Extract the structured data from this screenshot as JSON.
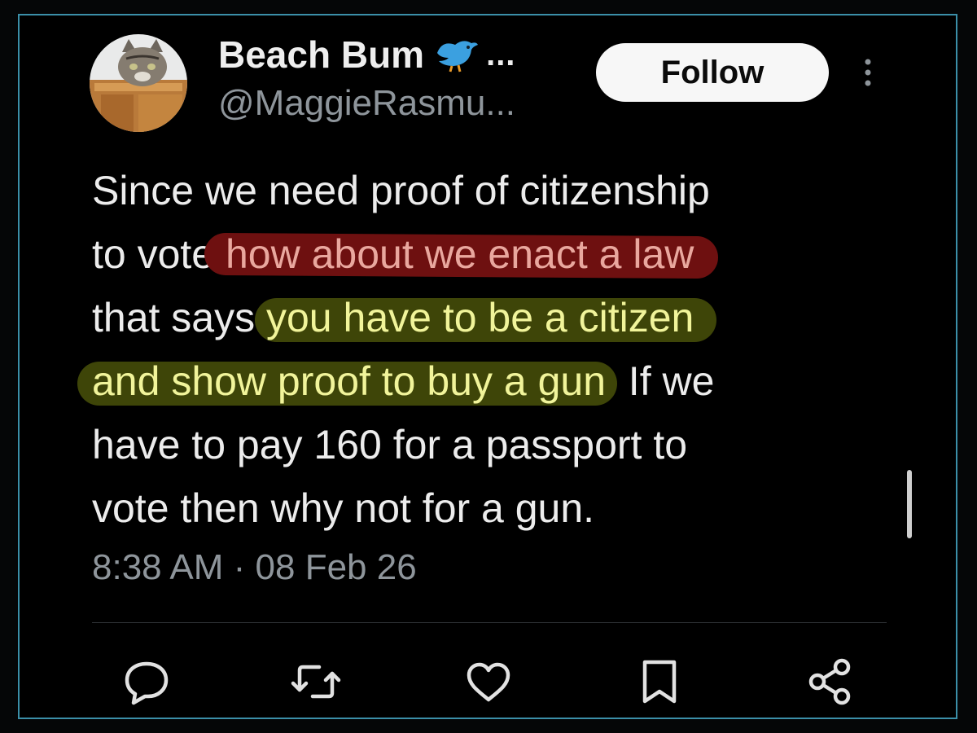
{
  "author": {
    "name": "Beach Bum",
    "name_truncation": "...",
    "handle": "@MaggieRasmu..."
  },
  "follow_label": "Follow",
  "tweet": {
    "line1": "Since we need proof of citizenship",
    "line2_plain": "to vote ",
    "line2_red": "how about we enact a law",
    "line3_plain": "that says ",
    "line3_yellow": "you have to be a citizen",
    "line4_yellow": "and show proof to buy a gun",
    "line4_plain": ". If we",
    "line5": "have to pay 160 for a passport to",
    "line6": "vote then why not for a gun."
  },
  "timestamp": "8:38 AM · 08 Feb 26",
  "actions": [
    "reply-icon",
    "retweet-icon",
    "like-icon",
    "bookmark-icon",
    "share-icon"
  ],
  "colors": {
    "background": "#000000",
    "red_highlight": "#6e1010",
    "yellow_highlight": "#3e4508",
    "bird": "#3ba0e0"
  }
}
